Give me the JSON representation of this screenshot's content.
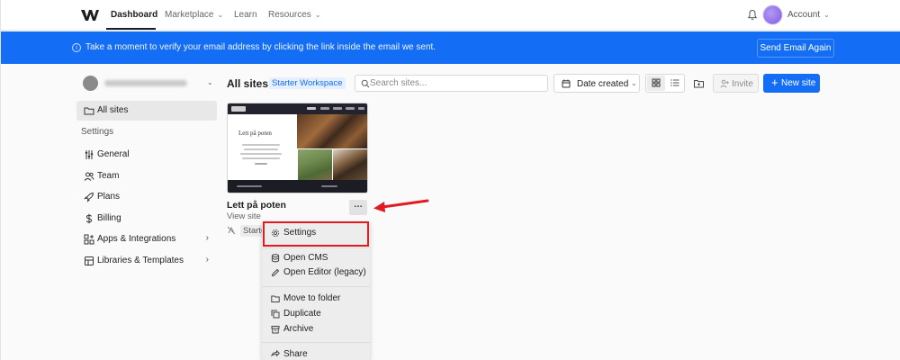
{
  "colors": {
    "brand_blue": "#146ef5",
    "annotation_red": "#e01b22",
    "page_bg": "#fafafa"
  },
  "topnav": {
    "items": [
      {
        "label": "Dashboard",
        "active": true
      },
      {
        "label": "Marketplace",
        "has_chevron": true
      },
      {
        "label": "Learn"
      },
      {
        "label": "Resources",
        "has_chevron": true
      }
    ],
    "account_label": "Account",
    "icons": [
      "webflow-logo-icon",
      "bell-icon",
      "avatar",
      "chevron-down-icon"
    ]
  },
  "banner": {
    "message": "Take a moment to verify your email address by clicking the link inside the email we sent.",
    "button_label": "Send Email Again"
  },
  "sidebar": {
    "items": [
      {
        "label": "All sites",
        "icon": "folder-icon",
        "selected": true
      },
      {
        "label": "General",
        "icon": "sliders-icon"
      },
      {
        "label": "Team",
        "icon": "users-icon"
      },
      {
        "label": "Plans",
        "icon": "rocket-icon"
      },
      {
        "label": "Billing",
        "icon": "dollar-icon"
      },
      {
        "label": "Apps & Integrations",
        "icon": "grid-plus-icon",
        "has_arrow": true
      },
      {
        "label": "Libraries & Templates",
        "icon": "library-icon",
        "has_arrow": true
      }
    ],
    "settings_heading": "Settings"
  },
  "toolbar": {
    "title": "All sites",
    "workspace_badge": "Starter Workspace",
    "search_placeholder": "Search sites...",
    "sort_label": "Date created",
    "invite_label": "Invite",
    "new_site_label": "New site"
  },
  "site": {
    "name": "Lett på poten",
    "link_label": "View site",
    "plan_label": "Starter",
    "thumbnail_title": "Lett på poten"
  },
  "menu": {
    "items": [
      {
        "label": "Settings",
        "icon": "gear-icon",
        "group": 1
      },
      {
        "label": "Open CMS",
        "icon": "database-icon",
        "group": 2
      },
      {
        "label": "Open Editor (legacy)",
        "icon": "pencil-icon",
        "group": 2
      },
      {
        "label": "Move to folder",
        "icon": "folder-icon",
        "group": 3
      },
      {
        "label": "Duplicate",
        "icon": "copy-icon",
        "group": 3
      },
      {
        "label": "Archive",
        "icon": "archive-icon",
        "group": 3
      },
      {
        "label": "Share",
        "icon": "share-icon",
        "group": 4
      }
    ]
  }
}
